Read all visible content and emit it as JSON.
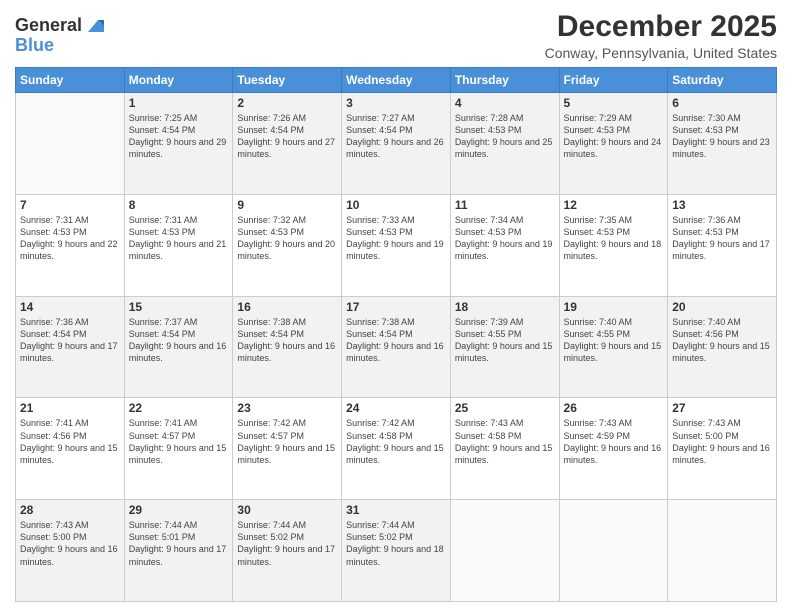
{
  "header": {
    "logo_general": "General",
    "logo_blue": "Blue",
    "title": "December 2025",
    "subtitle": "Conway, Pennsylvania, United States"
  },
  "calendar": {
    "days_of_week": [
      "Sunday",
      "Monday",
      "Tuesday",
      "Wednesday",
      "Thursday",
      "Friday",
      "Saturday"
    ],
    "weeks": [
      [
        {
          "day": "",
          "info": ""
        },
        {
          "day": "1",
          "info": "Sunrise: 7:25 AM\nSunset: 4:54 PM\nDaylight: 9 hours and 29 minutes."
        },
        {
          "day": "2",
          "info": "Sunrise: 7:26 AM\nSunset: 4:54 PM\nDaylight: 9 hours and 27 minutes."
        },
        {
          "day": "3",
          "info": "Sunrise: 7:27 AM\nSunset: 4:54 PM\nDaylight: 9 hours and 26 minutes."
        },
        {
          "day": "4",
          "info": "Sunrise: 7:28 AM\nSunset: 4:53 PM\nDaylight: 9 hours and 25 minutes."
        },
        {
          "day": "5",
          "info": "Sunrise: 7:29 AM\nSunset: 4:53 PM\nDaylight: 9 hours and 24 minutes."
        },
        {
          "day": "6",
          "info": "Sunrise: 7:30 AM\nSunset: 4:53 PM\nDaylight: 9 hours and 23 minutes."
        }
      ],
      [
        {
          "day": "7",
          "info": "Sunrise: 7:31 AM\nSunset: 4:53 PM\nDaylight: 9 hours and 22 minutes."
        },
        {
          "day": "8",
          "info": "Sunrise: 7:31 AM\nSunset: 4:53 PM\nDaylight: 9 hours and 21 minutes."
        },
        {
          "day": "9",
          "info": "Sunrise: 7:32 AM\nSunset: 4:53 PM\nDaylight: 9 hours and 20 minutes."
        },
        {
          "day": "10",
          "info": "Sunrise: 7:33 AM\nSunset: 4:53 PM\nDaylight: 9 hours and 19 minutes."
        },
        {
          "day": "11",
          "info": "Sunrise: 7:34 AM\nSunset: 4:53 PM\nDaylight: 9 hours and 19 minutes."
        },
        {
          "day": "12",
          "info": "Sunrise: 7:35 AM\nSunset: 4:53 PM\nDaylight: 9 hours and 18 minutes."
        },
        {
          "day": "13",
          "info": "Sunrise: 7:36 AM\nSunset: 4:53 PM\nDaylight: 9 hours and 17 minutes."
        }
      ],
      [
        {
          "day": "14",
          "info": "Sunrise: 7:36 AM\nSunset: 4:54 PM\nDaylight: 9 hours and 17 minutes."
        },
        {
          "day": "15",
          "info": "Sunrise: 7:37 AM\nSunset: 4:54 PM\nDaylight: 9 hours and 16 minutes."
        },
        {
          "day": "16",
          "info": "Sunrise: 7:38 AM\nSunset: 4:54 PM\nDaylight: 9 hours and 16 minutes."
        },
        {
          "day": "17",
          "info": "Sunrise: 7:38 AM\nSunset: 4:54 PM\nDaylight: 9 hours and 16 minutes."
        },
        {
          "day": "18",
          "info": "Sunrise: 7:39 AM\nSunset: 4:55 PM\nDaylight: 9 hours and 15 minutes."
        },
        {
          "day": "19",
          "info": "Sunrise: 7:40 AM\nSunset: 4:55 PM\nDaylight: 9 hours and 15 minutes."
        },
        {
          "day": "20",
          "info": "Sunrise: 7:40 AM\nSunset: 4:56 PM\nDaylight: 9 hours and 15 minutes."
        }
      ],
      [
        {
          "day": "21",
          "info": "Sunrise: 7:41 AM\nSunset: 4:56 PM\nDaylight: 9 hours and 15 minutes."
        },
        {
          "day": "22",
          "info": "Sunrise: 7:41 AM\nSunset: 4:57 PM\nDaylight: 9 hours and 15 minutes."
        },
        {
          "day": "23",
          "info": "Sunrise: 7:42 AM\nSunset: 4:57 PM\nDaylight: 9 hours and 15 minutes."
        },
        {
          "day": "24",
          "info": "Sunrise: 7:42 AM\nSunset: 4:58 PM\nDaylight: 9 hours and 15 minutes."
        },
        {
          "day": "25",
          "info": "Sunrise: 7:43 AM\nSunset: 4:58 PM\nDaylight: 9 hours and 15 minutes."
        },
        {
          "day": "26",
          "info": "Sunrise: 7:43 AM\nSunset: 4:59 PM\nDaylight: 9 hours and 16 minutes."
        },
        {
          "day": "27",
          "info": "Sunrise: 7:43 AM\nSunset: 5:00 PM\nDaylight: 9 hours and 16 minutes."
        }
      ],
      [
        {
          "day": "28",
          "info": "Sunrise: 7:43 AM\nSunset: 5:00 PM\nDaylight: 9 hours and 16 minutes."
        },
        {
          "day": "29",
          "info": "Sunrise: 7:44 AM\nSunset: 5:01 PM\nDaylight: 9 hours and 17 minutes."
        },
        {
          "day": "30",
          "info": "Sunrise: 7:44 AM\nSunset: 5:02 PM\nDaylight: 9 hours and 17 minutes."
        },
        {
          "day": "31",
          "info": "Sunrise: 7:44 AM\nSunset: 5:02 PM\nDaylight: 9 hours and 18 minutes."
        },
        {
          "day": "",
          "info": ""
        },
        {
          "day": "",
          "info": ""
        },
        {
          "day": "",
          "info": ""
        }
      ]
    ]
  }
}
